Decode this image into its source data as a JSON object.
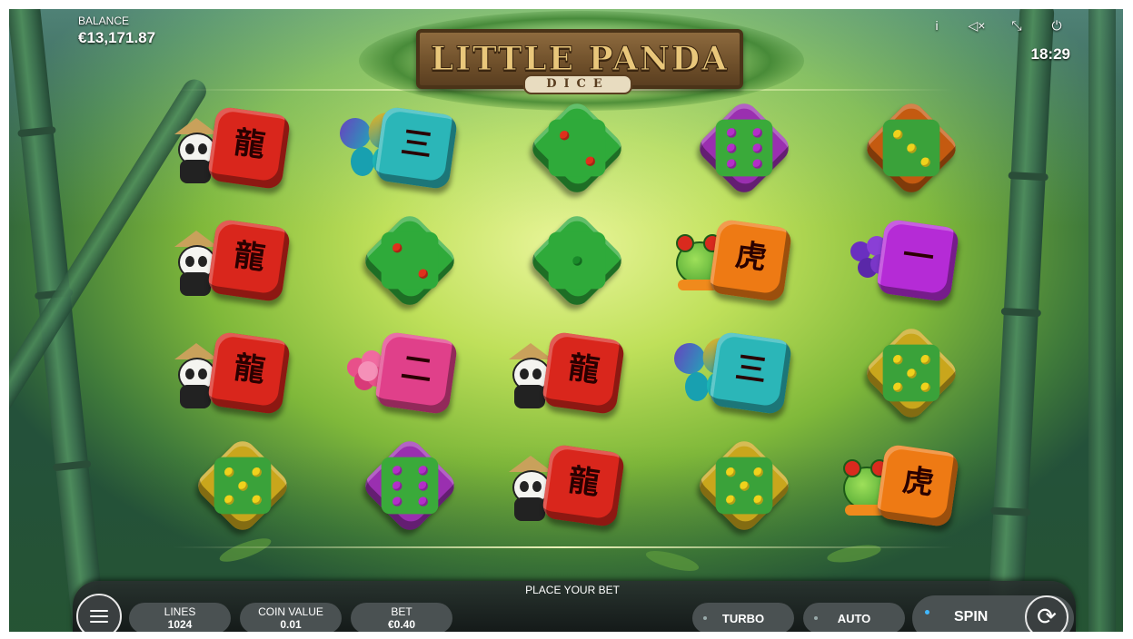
{
  "hud": {
    "balance_label": "BALANCE",
    "balance_value": "€13,171.87",
    "clock": "18:29",
    "icons": [
      "info-icon",
      "sound-muted-icon",
      "fullscreen-exit-icon",
      "power-icon"
    ]
  },
  "logo": {
    "title": "LITTLE PANDA",
    "subtitle": "DICE"
  },
  "reels": {
    "columns": 5,
    "rows": 4,
    "symbols": [
      [
        {
          "type": "panda-dragon",
          "die_color": "#d9261c",
          "glyph": "龍"
        },
        {
          "type": "butterfly-die",
          "die_color": "#2bb6b8",
          "glyph": "三"
        },
        {
          "type": "die",
          "die_color": "#2faa3a",
          "pips": 2,
          "pip_color": "#e0301c"
        },
        {
          "type": "die",
          "die_color": "#3aaa3a",
          "pips": 6,
          "pip_color": "#b32fc9",
          "frame_color": "#9a2fb0"
        },
        {
          "type": "die",
          "die_color": "#3aa23a",
          "pips": 3,
          "pip_color": "#f0d21c",
          "frame_color": "#c45a10"
        }
      ],
      [
        {
          "type": "panda-dragon",
          "die_color": "#d9261c",
          "glyph": "龍"
        },
        {
          "type": "die",
          "die_color": "#2faa3a",
          "pips": 2,
          "pip_color": "#e0301c"
        },
        {
          "type": "die",
          "die_color": "#2faa3a",
          "pips": 1,
          "pip_color": "#1a8a2a"
        },
        {
          "type": "frog-tiger",
          "die_color": "#ee7a14",
          "glyph": "虎"
        },
        {
          "type": "iris-die",
          "die_color": "#b52bd6",
          "glyph": "一"
        }
      ],
      [
        {
          "type": "panda-dragon",
          "die_color": "#d9261c",
          "glyph": "龍"
        },
        {
          "type": "peony-die",
          "die_color": "#e0408a",
          "glyph": "二"
        },
        {
          "type": "panda-dragon",
          "die_color": "#d9261c",
          "glyph": "龍"
        },
        {
          "type": "butterfly-die",
          "die_color": "#2bb6b8",
          "glyph": "三"
        },
        {
          "type": "die",
          "die_color": "#3aa23a",
          "pips": 5,
          "pip_color": "#f0d21c",
          "frame_color": "#c9a61c"
        }
      ],
      [
        {
          "type": "die",
          "die_color": "#3aa23a",
          "pips": 5,
          "pip_color": "#f0d21c",
          "frame_color": "#c9a61c"
        },
        {
          "type": "die",
          "die_color": "#3aaa3a",
          "pips": 6,
          "pip_color": "#b32fc9",
          "frame_color": "#9a2fb0"
        },
        {
          "type": "panda-dragon",
          "die_color": "#d9261c",
          "glyph": "龍"
        },
        {
          "type": "die",
          "die_color": "#3aa23a",
          "pips": 5,
          "pip_color": "#f0d21c",
          "frame_color": "#c9a61c"
        },
        {
          "type": "frog-tiger",
          "die_color": "#ee7a14",
          "glyph": "虎"
        }
      ]
    ]
  },
  "controls": {
    "status": "PLACE YOUR BET",
    "lines_label": "LINES",
    "lines_value": "1024",
    "coin_label": "COIN VALUE",
    "coin_value": "0.01",
    "bet_label": "BET",
    "bet_value": "€0.40",
    "turbo_label": "TURBO",
    "auto_label": "AUTO",
    "spin_label": "SPIN"
  }
}
